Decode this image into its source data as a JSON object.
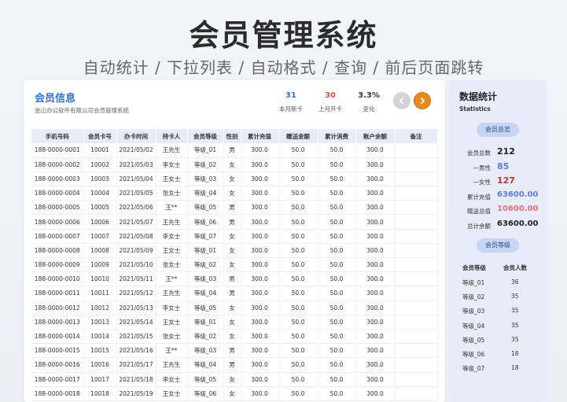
{
  "hero": {
    "title": "会员管理系统",
    "subtitle": "自动统计 / 下拉列表 / 自动格式 / 查询 / 前后页面跳转"
  },
  "card": {
    "title": "会员信息",
    "company": "金山办公软件有限公司会员管理系统",
    "stats": [
      {
        "value": "31",
        "label": "本月新卡",
        "color": "#3a6fd0"
      },
      {
        "value": "30",
        "label": "上月开卡",
        "color": "#d9534f"
      },
      {
        "value": "3.3%",
        "label": "变化",
        "color": "#333333"
      }
    ]
  },
  "table": {
    "headers": [
      "手机号码",
      "会员卡号",
      "办卡时间",
      "持卡人",
      "会员等级",
      "性别",
      "累计充值",
      "赠送金额",
      "累计消费",
      "账户余额",
      "备注"
    ],
    "rows": [
      [
        "188-0000-0001",
        "10001",
        "2021/05/02",
        "王先生",
        "等级_01",
        "男",
        "300.0",
        "50.0",
        "50.0",
        "300.0",
        ""
      ],
      [
        "188-0000-0002",
        "10002",
        "2021/05/03",
        "李女士",
        "等级_02",
        "女",
        "300.0",
        "50.0",
        "50.0",
        "300.0",
        ""
      ],
      [
        "188-0000-0003",
        "10003",
        "2021/05/04",
        "王女士",
        "等级_03",
        "女",
        "300.0",
        "50.0",
        "50.0",
        "300.0",
        ""
      ],
      [
        "188-0000-0004",
        "10004",
        "2021/05/05",
        "张女士",
        "等级_04",
        "女",
        "300.0",
        "50.0",
        "50.0",
        "300.0",
        ""
      ],
      [
        "188-0000-0005",
        "10005",
        "2021/05/06",
        "王**",
        "等级_05",
        "男",
        "300.0",
        "50.0",
        "50.0",
        "300.0",
        ""
      ],
      [
        "188-0000-0006",
        "10006",
        "2021/05/07",
        "王先生",
        "等级_06",
        "男",
        "300.0",
        "50.0",
        "50.0",
        "300.0",
        ""
      ],
      [
        "188-0000-0007",
        "10007",
        "2021/05/08",
        "李女士",
        "等级_07",
        "女",
        "300.0",
        "50.0",
        "50.0",
        "300.0",
        ""
      ],
      [
        "188-0000-0008",
        "10008",
        "2021/05/09",
        "王女士",
        "等级_01",
        "女",
        "300.0",
        "50.0",
        "50.0",
        "300.0",
        ""
      ],
      [
        "188-0000-0009",
        "10009",
        "2021/05/10",
        "张女士",
        "等级_02",
        "女",
        "300.0",
        "50.0",
        "50.0",
        "300.0",
        ""
      ],
      [
        "188-0000-0010",
        "10010",
        "2021/05/11",
        "王**",
        "等级_03",
        "男",
        "300.0",
        "50.0",
        "50.0",
        "300.0",
        ""
      ],
      [
        "188-0000-0011",
        "10011",
        "2021/05/12",
        "王先生",
        "等级_04",
        "男",
        "300.0",
        "50.0",
        "50.0",
        "300.0",
        ""
      ],
      [
        "188-0000-0012",
        "10012",
        "2021/05/13",
        "李女士",
        "等级_05",
        "女",
        "300.0",
        "50.0",
        "50.0",
        "300.0",
        ""
      ],
      [
        "188-0000-0013",
        "10013",
        "2021/05/14",
        "王女士",
        "等级_01",
        "女",
        "300.0",
        "50.0",
        "50.0",
        "300.0",
        ""
      ],
      [
        "188-0000-0014",
        "10014",
        "2021/05/15",
        "张女士",
        "等级_02",
        "女",
        "300.0",
        "50.0",
        "50.0",
        "300.0",
        ""
      ],
      [
        "188-0000-0015",
        "10015",
        "2021/05/16",
        "王**",
        "等级_03",
        "男",
        "300.0",
        "50.0",
        "50.0",
        "300.0",
        ""
      ],
      [
        "188-0000-0016",
        "10016",
        "2021/05/17",
        "王先生",
        "等级_04",
        "男",
        "300.0",
        "50.0",
        "50.0",
        "300.0",
        ""
      ],
      [
        "188-0000-0017",
        "10017",
        "2021/05/18",
        "李女士",
        "等级_05",
        "女",
        "300.0",
        "50.0",
        "50.0",
        "300.0",
        ""
      ],
      [
        "188-0000-0018",
        "10018",
        "2021/05/19",
        "王女士",
        "等级_06",
        "女",
        "300.0",
        "50.0",
        "50.0",
        "300.0",
        ""
      ]
    ]
  },
  "side": {
    "title": "数据统计",
    "subtitle": "Statistics",
    "overview_label": "会员总览",
    "overview": [
      {
        "label": "会员总数",
        "value": "212",
        "color": "#222222"
      },
      {
        "label": "—男性",
        "value": "85",
        "color": "#5b7fd6"
      },
      {
        "label": "—女性",
        "value": "127",
        "color": "#c0392b"
      },
      {
        "label": "累计充值",
        "value": "63600.00",
        "color": "#5b7fd6"
      },
      {
        "label": "赠送总值",
        "value": "10600.00",
        "color": "#e0707a"
      },
      {
        "label": "总计余额",
        "value": "63600.00",
        "color": "#222222"
      }
    ],
    "levels_label": "会员等级",
    "levels_headers": [
      "会员等级",
      "会员人数"
    ],
    "levels": [
      {
        "name": "等级_01",
        "count": "36"
      },
      {
        "name": "等级_02",
        "count": "35"
      },
      {
        "name": "等级_03",
        "count": "35"
      },
      {
        "name": "等级_04",
        "count": "35"
      },
      {
        "name": "等级_05",
        "count": "35"
      },
      {
        "name": "等级_06",
        "count": "18"
      },
      {
        "name": "等级_07",
        "count": "18"
      }
    ]
  }
}
